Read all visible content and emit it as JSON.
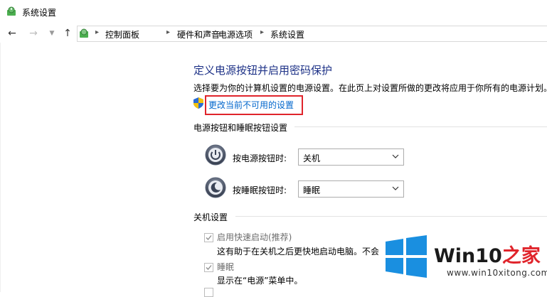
{
  "window": {
    "title": "系统设置"
  },
  "breadcrumb": [
    "控制面板",
    "硬件和声音",
    "电源选项",
    "系统设置"
  ],
  "main": {
    "heading": "定义电源按钮并启用密码保护",
    "subtitle": "选择要为你的计算机设置的电源设置。在此页上对设置所做的更改将应用于你所有的电源计划。",
    "change_link": "更改当前不可用的设置"
  },
  "buttons_section": {
    "title": "电源按钮和睡眠按钮设置",
    "power_label": "按电源按钮时:",
    "power_value": "关机",
    "sleep_label": "按睡眠按钮时:",
    "sleep_value": "睡眠"
  },
  "shutdown_section": {
    "title": "关机设置",
    "items": [
      {
        "label": "启用快速启动(推荐)",
        "desc": "这有助于在关机之后更快地启动电脑。不会",
        "checked": true
      },
      {
        "label": "睡眠",
        "desc": "显示在“电源”菜单中。",
        "checked": true
      }
    ]
  },
  "watermark": {
    "brand_prefix": "Win10",
    "brand_suffix": "之家",
    "url": "www.win10xitong.com"
  },
  "colors": {
    "accent_blue": "#1e3287",
    "link": "#0066cc",
    "highlight": "#e0242b",
    "win_blue": "#1a8fe0"
  }
}
